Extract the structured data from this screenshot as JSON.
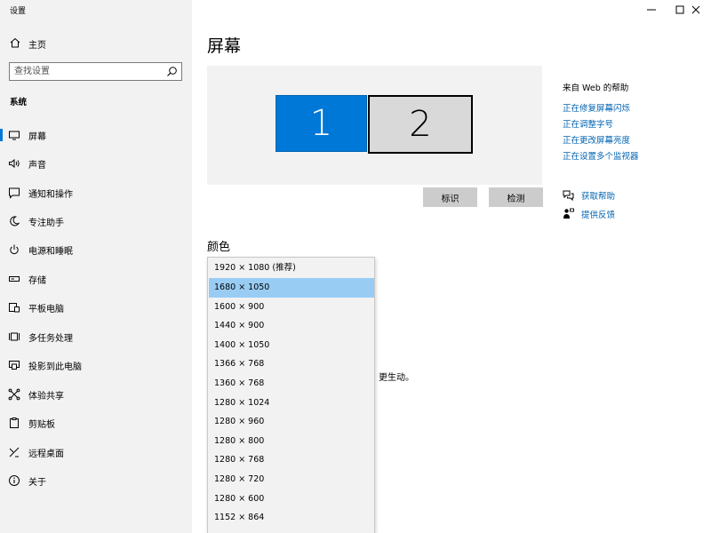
{
  "window": {
    "app_title": "设置",
    "controls": {
      "minimize": "minimize-icon",
      "maximize": "maximize-icon",
      "close": "close-icon"
    }
  },
  "sidebar": {
    "home_label": "主页",
    "search_placeholder": "查找设置",
    "section_title": "系统",
    "items": [
      {
        "label": "屏幕",
        "icon": "monitor-icon",
        "active": true
      },
      {
        "label": "声音",
        "icon": "speaker-icon"
      },
      {
        "label": "通知和操作",
        "icon": "notification-icon"
      },
      {
        "label": "专注助手",
        "icon": "moon-icon"
      },
      {
        "label": "电源和睡眠",
        "icon": "power-icon"
      },
      {
        "label": "存储",
        "icon": "storage-icon"
      },
      {
        "label": "平板电脑",
        "icon": "tablet-icon"
      },
      {
        "label": "多任务处理",
        "icon": "multitask-icon"
      },
      {
        "label": "投影到此电脑",
        "icon": "project-icon"
      },
      {
        "label": "体验共享",
        "icon": "share-icon"
      },
      {
        "label": "剪贴板",
        "icon": "clipboard-icon"
      },
      {
        "label": "远程桌面",
        "icon": "remote-desktop-icon"
      },
      {
        "label": "关于",
        "icon": "info-icon"
      }
    ]
  },
  "main": {
    "title": "屏幕",
    "monitors": [
      {
        "label": "1",
        "selected": true
      },
      {
        "label": "2",
        "selected": false
      }
    ],
    "identify_label": "标识",
    "detect_label": "检测",
    "color_title": "颜色",
    "partial_text": "彩、更生动。",
    "resolution_options": [
      "1920 × 1080 (推荐)",
      "1680 × 1050",
      "1600 × 900",
      "1440 × 900",
      "1400 × 1050",
      "1366 × 768",
      "1360 × 768",
      "1280 × 1024",
      "1280 × 960",
      "1280 × 800",
      "1280 × 768",
      "1280 × 720",
      "1280 × 600",
      "1152 × 864"
    ],
    "selected_resolution_index": 1
  },
  "help": {
    "title": "来自 Web 的帮助",
    "links": [
      "正在修复屏幕闪烁",
      "正在调整字号",
      "正在更改屏幕亮度",
      "正在设置多个监视器"
    ],
    "get_help": "获取帮助",
    "feedback": "提供反馈"
  },
  "colors": {
    "accent": "#0078d7",
    "link": "#0063b1",
    "sidebar_bg": "#f2f2f2",
    "selected_option": "#99ccf3",
    "button_bg": "#cccccc"
  }
}
